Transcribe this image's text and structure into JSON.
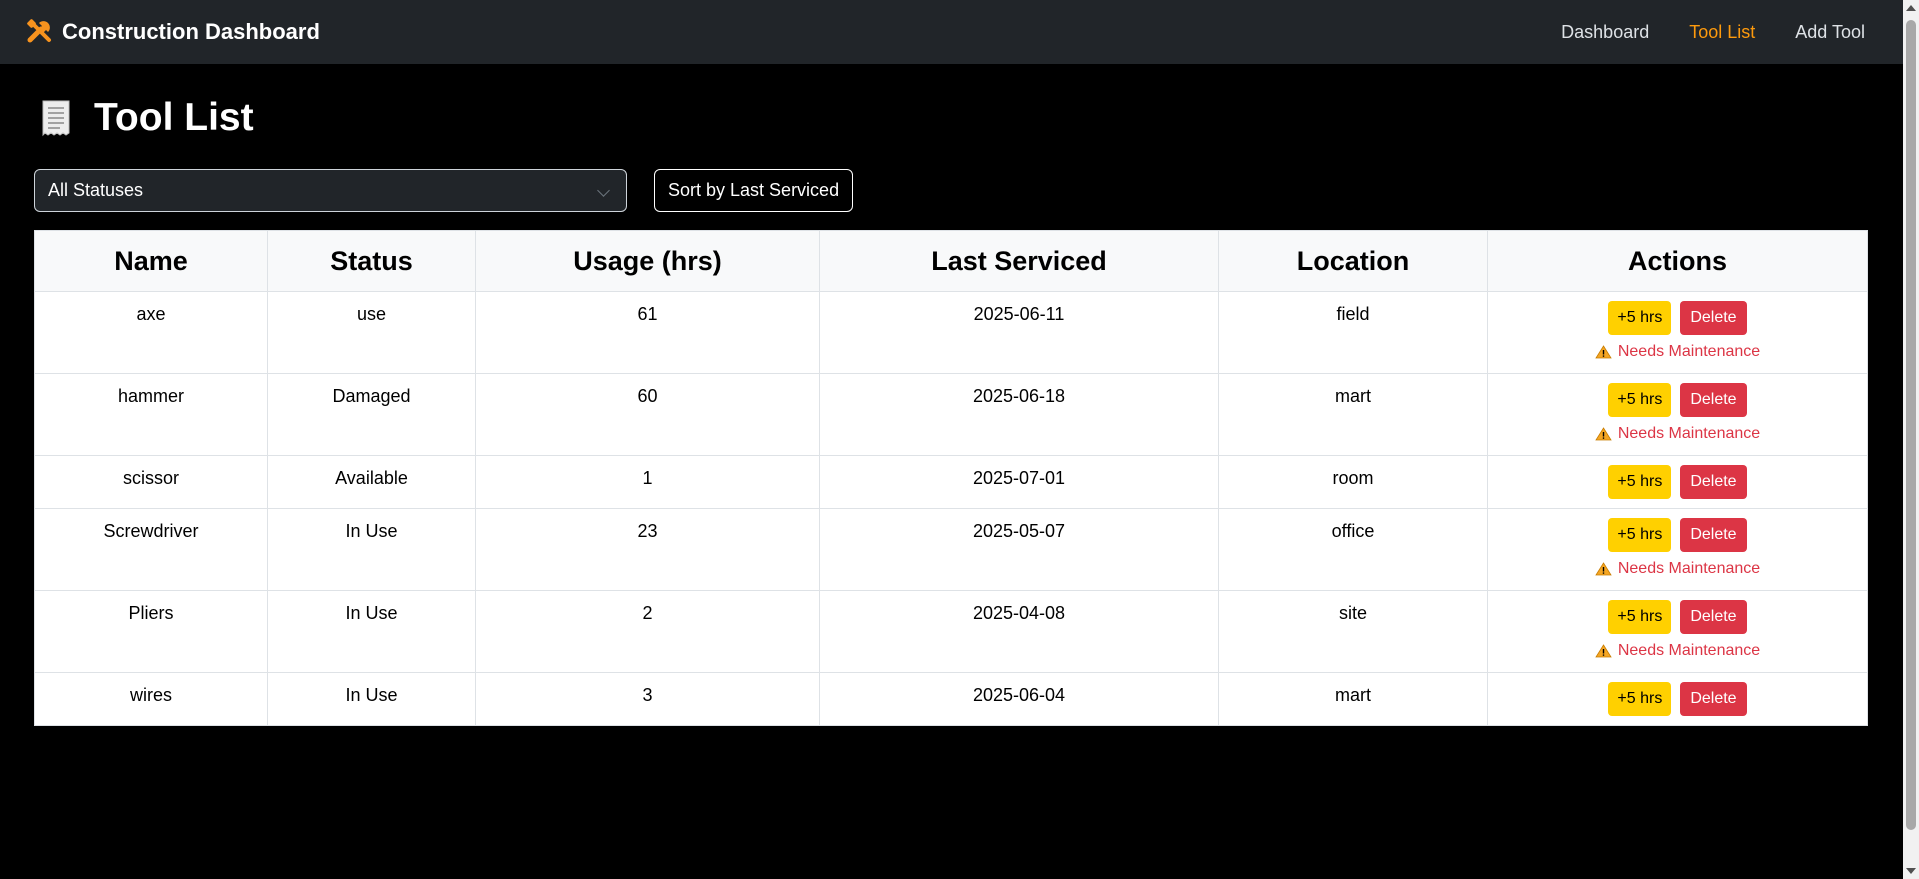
{
  "navbar": {
    "brand": "Construction Dashboard",
    "brand_icon": "tools-icon",
    "links": [
      "Dashboard",
      "Tool List",
      "Add Tool"
    ],
    "active_link": "Tool List",
    "accent_color": "#fd9a0d"
  },
  "page": {
    "title": "Tool List",
    "title_icon": "receipt-icon"
  },
  "filter": {
    "selected": "All Statuses"
  },
  "sort_button": "Sort by Last Serviced",
  "table": {
    "headers": [
      "Name",
      "Status",
      "Usage (hrs)",
      "Last Serviced",
      "Location",
      "Actions"
    ],
    "rows": [
      {
        "name": "axe",
        "status": "use",
        "usage": "61",
        "last_serviced": "2025-06-11",
        "location": "field",
        "needs_maintenance": true
      },
      {
        "name": "hammer",
        "status": "Damaged",
        "usage": "60",
        "last_serviced": "2025-06-18",
        "location": "mart",
        "needs_maintenance": true
      },
      {
        "name": "scissor",
        "status": "Available",
        "usage": "1",
        "last_serviced": "2025-07-01",
        "location": "room",
        "needs_maintenance": false
      },
      {
        "name": "Screwdriver",
        "status": "In Use",
        "usage": "23",
        "last_serviced": "2025-05-07",
        "location": "office",
        "needs_maintenance": true
      },
      {
        "name": "Pliers",
        "status": "In Use",
        "usage": "2",
        "last_serviced": "2025-04-08",
        "location": "site",
        "needs_maintenance": true
      },
      {
        "name": "wires",
        "status": "In Use",
        "usage": "3",
        "last_serviced": "2025-06-04",
        "location": "mart",
        "needs_maintenance": false
      }
    ]
  },
  "actions": {
    "add_hours_label": "+5 hrs",
    "delete_label": "Delete",
    "maintenance_label": "Needs Maintenance",
    "maintenance_icon": "warning-icon",
    "add_color": "#ffd000",
    "delete_color": "#dc3545"
  }
}
